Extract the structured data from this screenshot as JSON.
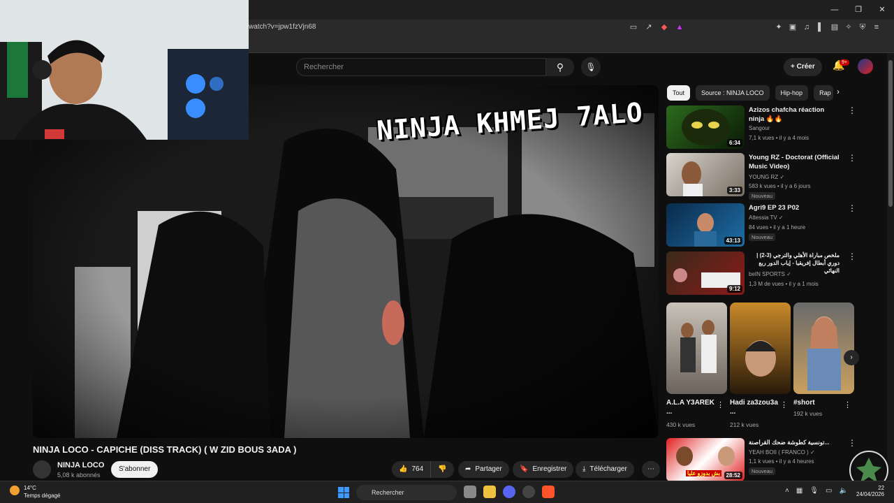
{
  "browser": {
    "url": "watch?v=jpw1fzVjn68"
  },
  "header": {
    "search_placeholder": "Rechercher",
    "create_label": "Créer",
    "notif_count": "9+"
  },
  "video": {
    "overlay_text": "NINJA KHMEJ 7ALO",
    "title": "NINJA LOCO - CAPICHE (DISS TRACK) ( W ZID BOUS 3ADA )",
    "channel": "NINJA LOCO",
    "subscribers": "5,08 k abonnés",
    "subscribe_label": "S'abonner",
    "likes": "764",
    "share_label": "Partager",
    "save_label": "Enregistrer",
    "download_label": "Télécharger"
  },
  "chips": [
    "Tout",
    "Source : NINJA LOCO",
    "Hip-hop",
    "Rap"
  ],
  "recommendations": [
    {
      "title": "Azizos chafcha réaction ninja 🔥🔥",
      "channel": "Sangour",
      "meta": "7,1 k vues • il y a 4 mois",
      "duration": "6:34",
      "badge": ""
    },
    {
      "title": "Young RZ - Doctorat (Official Music Video)",
      "channel": "YOUNG RZ ✓",
      "meta": "583 k vues • il y a 6 jours",
      "duration": "3:33",
      "badge": "Nouveau"
    },
    {
      "title": "Agri9 EP 23 P02",
      "channel": "Attessia TV ✓",
      "meta": "84 vues • il y a 1 heure",
      "duration": "43:13",
      "badge": "Nouveau"
    },
    {
      "title": "ملخص مباراة الأهلي والترجي (3-2) | دوري أبطال إفريقيا - إياب الدور ربع النهائي",
      "channel": "beIN SPORTS ✓",
      "meta": "1,3 M de vues • il y a 1 mois",
      "duration": "9:12",
      "badge": ""
    }
  ],
  "shorts": [
    {
      "title": "A.L.A Y3AREK ...",
      "views": "430 k vues"
    },
    {
      "title": "Hadi za3zou3a ...",
      "views": "212 k vues"
    },
    {
      "title": "#short",
      "views": "192 k vues"
    }
  ],
  "last_reco": {
    "title": "تونسية كطوشة ضحك القراصنة...",
    "channel": "YEAH BOII ( FRANCO ) ✓",
    "meta": "1,1 k vues • il y a 4 heures",
    "duration": "28:52",
    "badge": "Nouveau",
    "thumb_text": "بش بدوزو عليا"
  },
  "taskbar": {
    "temperature": "14°C",
    "weather": "Temps dégagé",
    "search_label": "Rechercher",
    "date": "24/04/2026",
    "time": "22"
  }
}
